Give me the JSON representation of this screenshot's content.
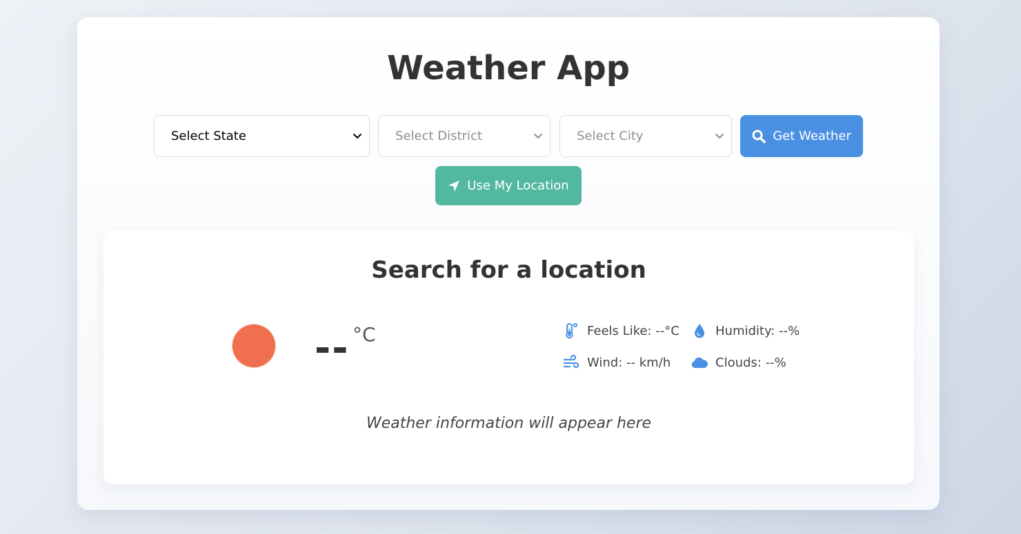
{
  "app": {
    "title": "Weather App"
  },
  "controls": {
    "state_select": {
      "selected": "Select State"
    },
    "district_select": {
      "selected": "Select District"
    },
    "city_select": {
      "selected": "Select City"
    },
    "get_weather_label": "Get Weather",
    "use_location_label": "Use My Location"
  },
  "weather": {
    "heading": "Search for a location",
    "temperature": "--",
    "temperature_unit": "°C",
    "details": {
      "feels_like": "Feels Like: --°C",
      "humidity": "Humidity: --%",
      "wind": "Wind: -- km/h",
      "clouds": "Clouds: --%"
    },
    "message": "Weather information will appear here"
  },
  "icons": {
    "search": "search-icon",
    "location": "location-arrow-icon",
    "weather_status": "sun-icon",
    "feels_like": "thermometer-icon",
    "humidity": "droplet-icon",
    "wind": "wind-icon",
    "clouds": "cloud-icon"
  },
  "colors": {
    "primary": "#4a90e2",
    "secondary": "#52b8a0",
    "sun": "#ef6f4e",
    "icon": "#4a90e2"
  }
}
